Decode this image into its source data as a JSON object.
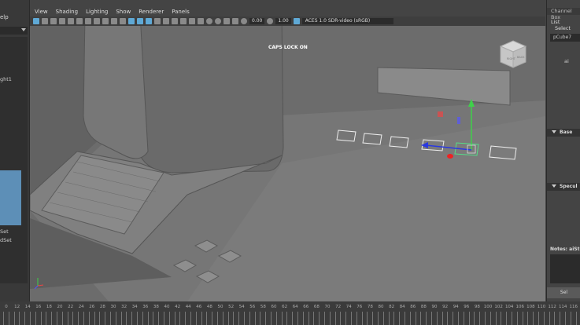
{
  "left_panel": {
    "menu_fragment": "elp",
    "outliner_items": [
      "ght1",
      "Set",
      "dSet"
    ]
  },
  "viewport": {
    "menu": [
      "View",
      "Shading",
      "Lighting",
      "Show",
      "Renderer",
      "Panels"
    ],
    "exposure_value": "0.00",
    "gamma_value": "1.00",
    "color_space": "ACES 1.0 SDR-video (sRGB)",
    "caps_lock_text": "CAPS LOCK ON",
    "viewcube_labels": [
      "RIGHT",
      "BACK"
    ]
  },
  "channel_box": {
    "header": "Channel Box",
    "tabs": [
      "List",
      "Select"
    ],
    "object_name": "pCube7",
    "attr_fragment": "ai",
    "sections": [
      "Base",
      "Specul"
    ],
    "notes_label": "Notes: aiSt",
    "select_button": "Sel"
  },
  "timeline": {
    "ticks": [
      "0",
      "12",
      "14",
      "16",
      "18",
      "20",
      "22",
      "24",
      "26",
      "28",
      "30",
      "32",
      "34",
      "36",
      "38",
      "40",
      "42",
      "44",
      "46",
      "48",
      "50",
      "52",
      "54",
      "56",
      "58",
      "60",
      "62",
      "64",
      "66",
      "68",
      "70",
      "72",
      "74",
      "76",
      "78",
      "80",
      "82",
      "84",
      "86",
      "88",
      "90",
      "92",
      "94",
      "96",
      "98",
      "100",
      "102",
      "104",
      "106",
      "108",
      "110",
      "112",
      "114",
      "116"
    ]
  }
}
